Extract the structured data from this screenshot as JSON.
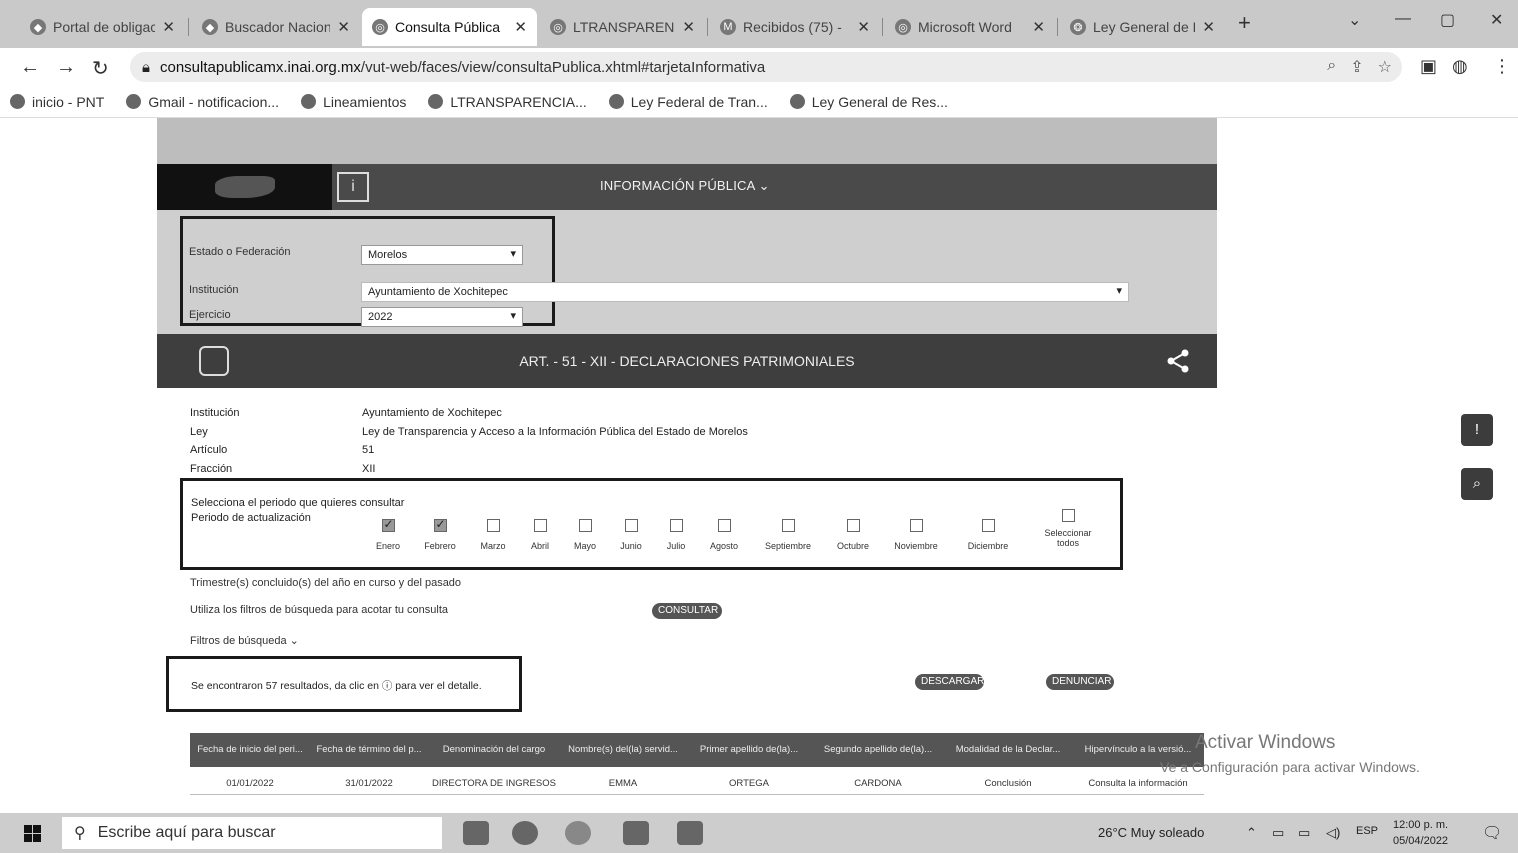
{
  "browser": {
    "tabs": [
      {
        "label": "Portal de obligac",
        "active": false
      },
      {
        "label": "Buscador Nacion",
        "active": false
      },
      {
        "label": "Consulta Pública",
        "active": true
      },
      {
        "label": "LTRANSPARENC",
        "active": false
      },
      {
        "label": "Recibidos (75) -",
        "active": false
      },
      {
        "label": "Microsoft Word",
        "active": false
      },
      {
        "label": "Ley General de R",
        "active": false
      }
    ],
    "url_host": "consultapublicamx.inai.org.mx",
    "url_path": "/vut-web/faces/view/consultaPublica.xhtml#tarjetaInformativa",
    "bookmarks": [
      "inicio - PNT",
      "Gmail - notificacion...",
      "Lineamientos",
      "LTRANSPARENCIA...",
      "Ley Federal de Tran...",
      "Ley General de Res..."
    ]
  },
  "portal": {
    "menu_label": "INFORMACIÓN PÚBLICA ⌄"
  },
  "filters": {
    "estado_label": "Estado o Federación",
    "estado_value": "Morelos",
    "institucion_label": "Institución",
    "institucion_value": "Ayuntamiento de Xochitepec",
    "ejercicio_label": "Ejercicio",
    "ejercicio_value": "2022"
  },
  "section": {
    "title": "ART. - 51 - XII - DECLARACIONES PATRIMONIALES"
  },
  "meta": {
    "institucion_k": "Institución",
    "institucion_v": "Ayuntamiento de Xochitepec",
    "ley_k": "Ley",
    "ley_v": "Ley de Transparencia y Acceso a la Información Pública del Estado de Morelos",
    "articulo_k": "Artículo",
    "articulo_v": "51",
    "fraccion_k": "Fracción",
    "fraccion_v": "XII"
  },
  "period": {
    "line1": "Selecciona el periodo que quieres consultar",
    "line2": "Periodo de actualización",
    "months": [
      {
        "label": "Enero",
        "checked": true
      },
      {
        "label": "Febrero",
        "checked": true
      },
      {
        "label": "Marzo",
        "checked": false
      },
      {
        "label": "Abril",
        "checked": false
      },
      {
        "label": "Mayo",
        "checked": false
      },
      {
        "label": "Junio",
        "checked": false
      },
      {
        "label": "Julio",
        "checked": false
      },
      {
        "label": "Agosto",
        "checked": false
      },
      {
        "label": "Septiembre",
        "checked": false
      },
      {
        "label": "Octubre",
        "checked": false
      },
      {
        "label": "Noviembre",
        "checked": false
      },
      {
        "label": "Diciembre",
        "checked": false
      }
    ],
    "select_all": "Seleccionar todos"
  },
  "texts": {
    "trimestres": "Trimestre(s) concluido(s) del año en curso y del pasado",
    "usa_filtros": "Utiliza los filtros de búsqueda para acotar tu consulta",
    "consultar": "CONSULTAR",
    "filtros": "Filtros de búsqueda ⌄",
    "results": "Se encontraron 57 resultados, da clic en  ⓘ  para ver el detalle.",
    "descargar": "DESCARGAR",
    "denunciar": "DENUNCIAR"
  },
  "table": {
    "headers": [
      "Fecha de inicio del peri...",
      "Fecha de término del p...",
      "Denominación del cargo",
      "Nombre(s) del(la) servid...",
      "Primer apellido de(la)...",
      "Segundo apellido de(la)...",
      "Modalidad de la Declar...",
      "Hipervínculo a la versió..."
    ],
    "rows": [
      [
        "01/01/2022",
        "31/01/2022",
        "DIRECTORA DE INGRESOS",
        "EMMA",
        "ORTEGA",
        "CARDONA",
        "Conclusión",
        "Consulta la información"
      ]
    ]
  },
  "watermark": {
    "line1": "Activar Windows",
    "line2": "Ve a Configuración para activar Windows."
  },
  "taskbar": {
    "search_placeholder": "Escribe aquí para buscar",
    "weather": "26°C Muy soleado",
    "lang": "ESP",
    "time": "12:00 p. m.",
    "date": "05/04/2022"
  }
}
